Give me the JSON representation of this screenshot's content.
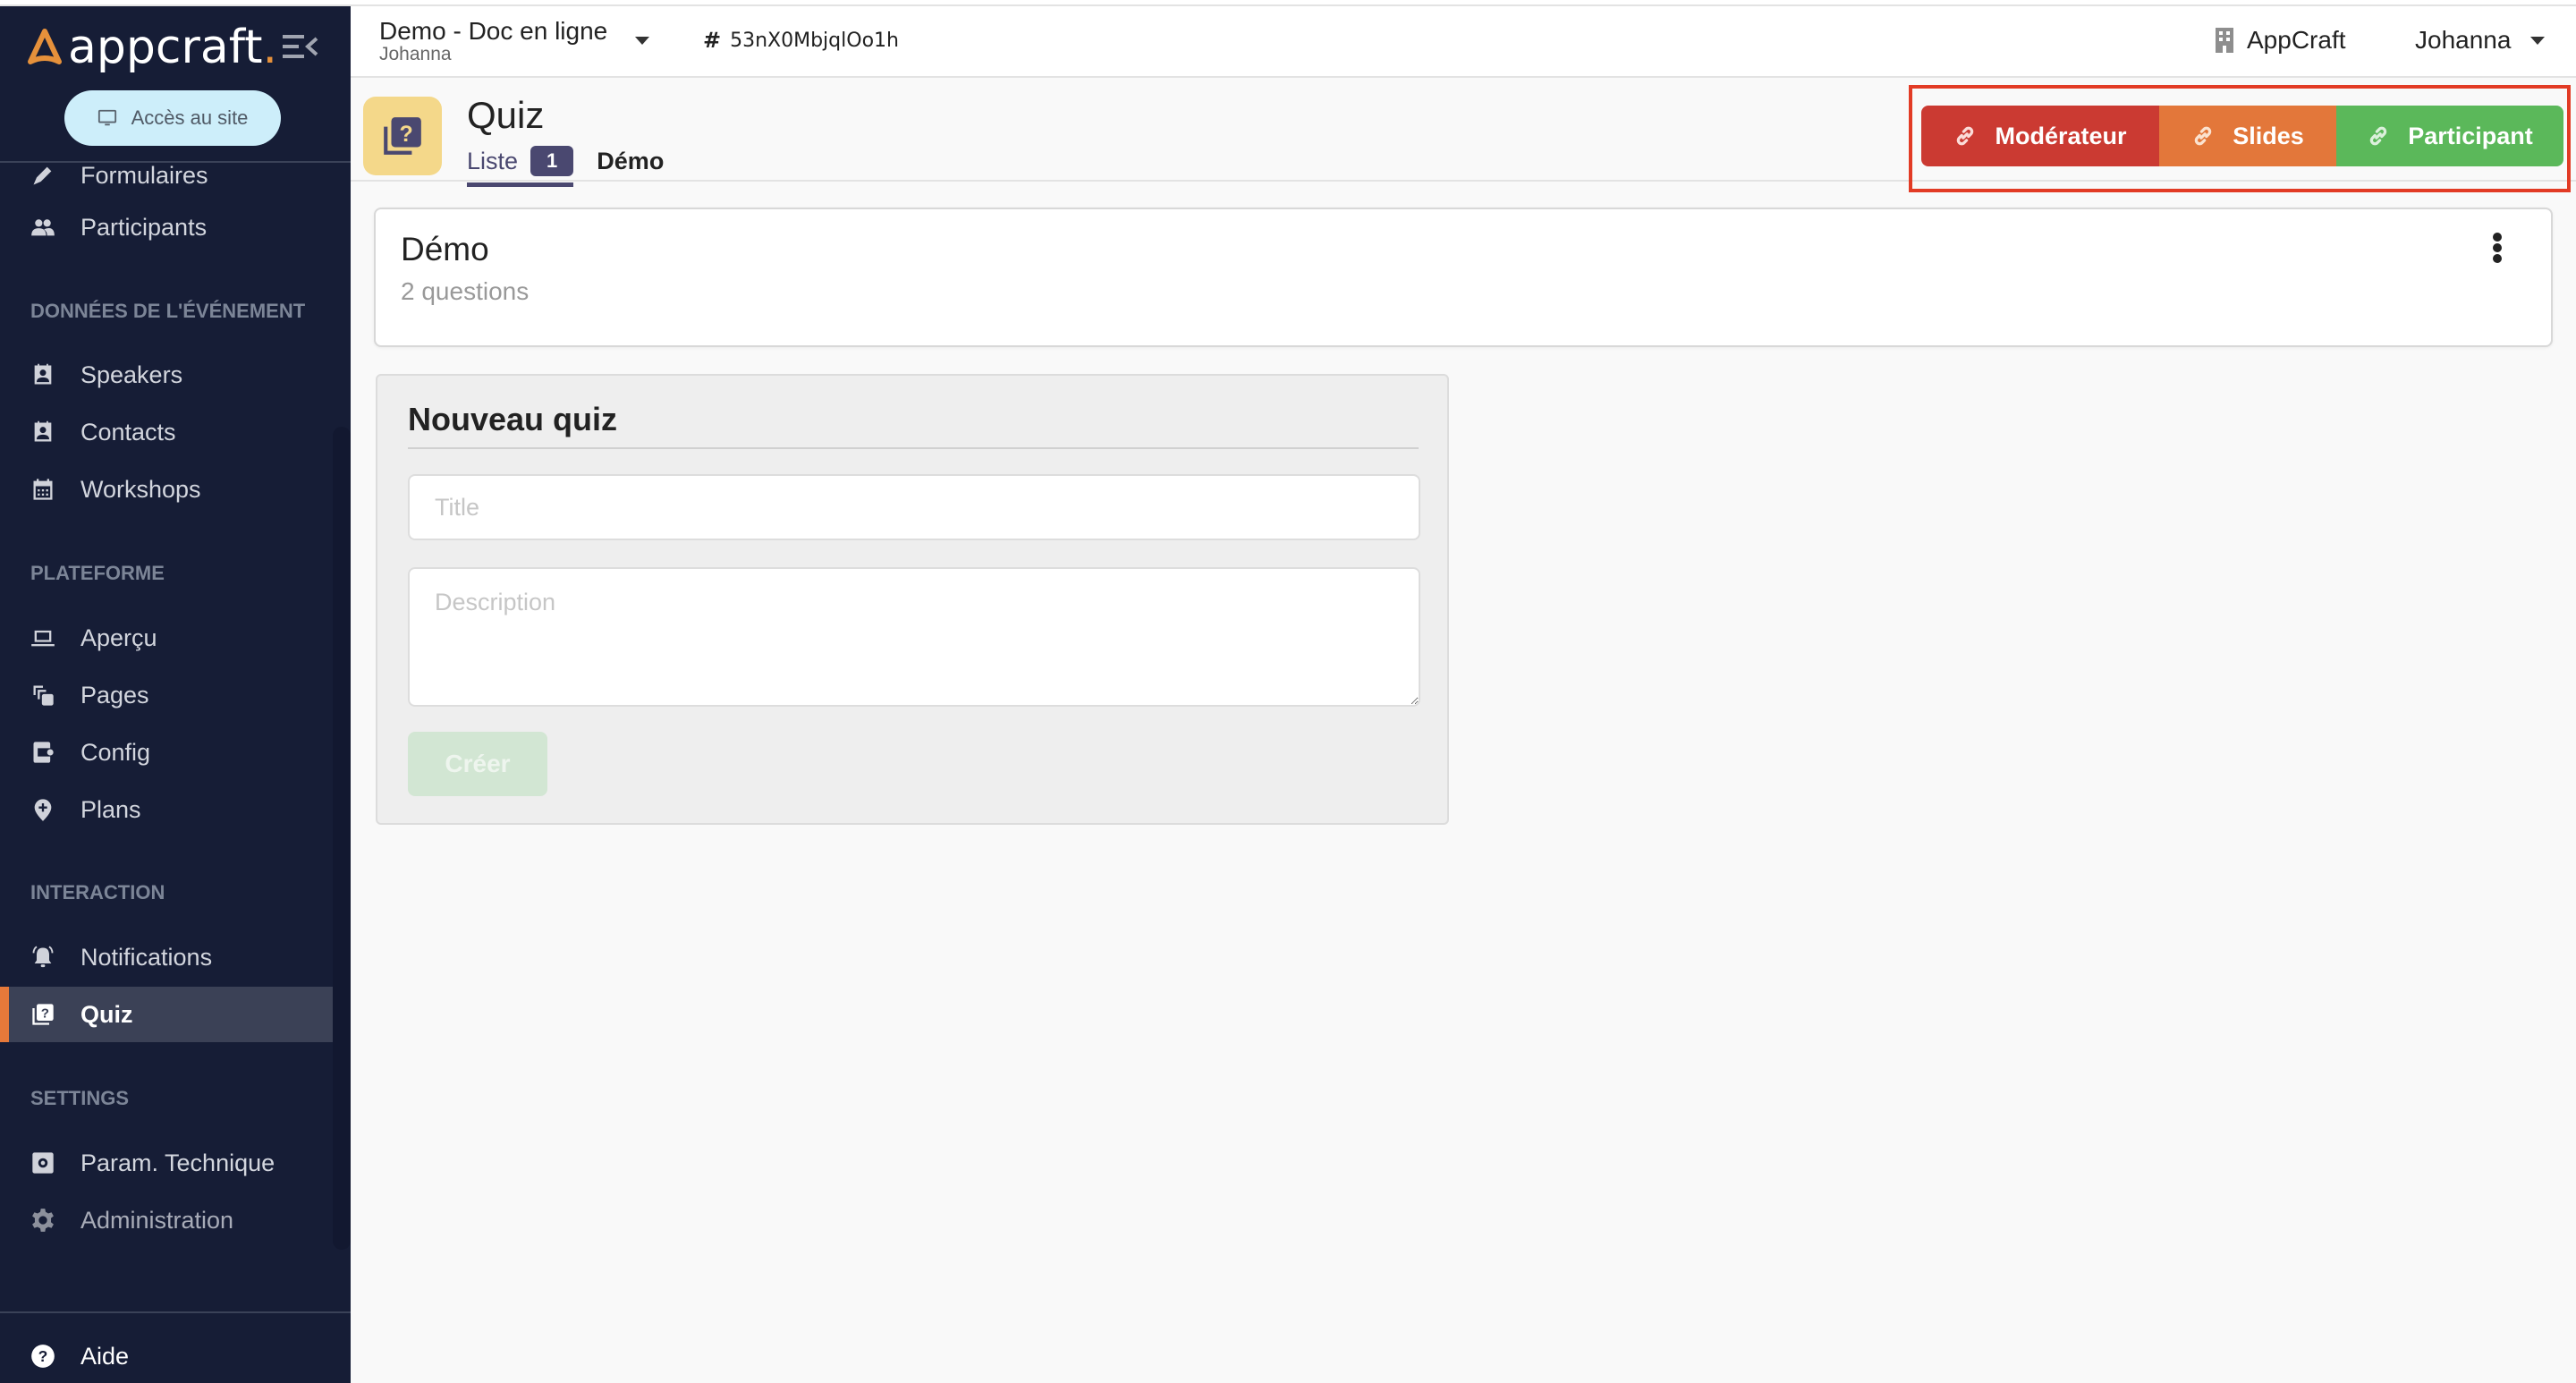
{
  "brand": {
    "name": "appcraft",
    "dot": ".",
    "accent_color": "#e6913b"
  },
  "sidebar": {
    "site_button_label": "Accès au site",
    "items_top": [
      {
        "label": "Formulaires",
        "icon": "pen-icon"
      },
      {
        "label": "Participants",
        "icon": "users-icon"
      }
    ],
    "sections": [
      {
        "title": "DONNÉES DE L'ÉVÉNEMENT",
        "items": [
          {
            "label": "Speakers",
            "icon": "contact-card-icon"
          },
          {
            "label": "Contacts",
            "icon": "contact-card-icon"
          },
          {
            "label": "Workshops",
            "icon": "calendar-icon"
          }
        ]
      },
      {
        "title": "PLATEFORME",
        "items": [
          {
            "label": "Aperçu",
            "icon": "laptop-icon"
          },
          {
            "label": "Pages",
            "icon": "pages-icon"
          },
          {
            "label": "Config",
            "icon": "device-settings-icon"
          },
          {
            "label": "Plans",
            "icon": "map-pin-plus-icon"
          }
        ]
      },
      {
        "title": "INTERACTION",
        "items": [
          {
            "label": "Notifications",
            "icon": "bell-ring-icon"
          },
          {
            "label": "Quiz",
            "icon": "quiz-icon",
            "active": true
          }
        ]
      },
      {
        "title": "SETTINGS",
        "items": [
          {
            "label": "Param. Technique",
            "icon": "settings-box-icon"
          },
          {
            "label": "Administration",
            "icon": "gear-icon"
          }
        ]
      }
    ],
    "help_label": "Aide",
    "active_color": "#e6793a"
  },
  "topbar": {
    "project_name": "Demo - Doc en ligne",
    "project_user": "Johanna",
    "hash_symbol": "#",
    "project_id": "53nX0MbjqlOo1h",
    "organization": "AppCraft",
    "user_name": "Johanna"
  },
  "page": {
    "title": "Quiz",
    "tabs": [
      {
        "label": "Liste",
        "badge": "1",
        "active": true
      },
      {
        "label": "Démo"
      }
    ],
    "actions": [
      {
        "label": "Modérateur",
        "color": "#cb3a32"
      },
      {
        "label": "Slides",
        "color": "#e3773a"
      },
      {
        "label": "Participant",
        "color": "#5bb85a"
      }
    ]
  },
  "quiz_list": [
    {
      "title": "Démo",
      "subtitle": "2 questions"
    }
  ],
  "new_quiz": {
    "heading": "Nouveau quiz",
    "title_value": "",
    "title_placeholder": "Title",
    "description_value": "",
    "description_placeholder": "Description",
    "create_label": "Créer"
  }
}
